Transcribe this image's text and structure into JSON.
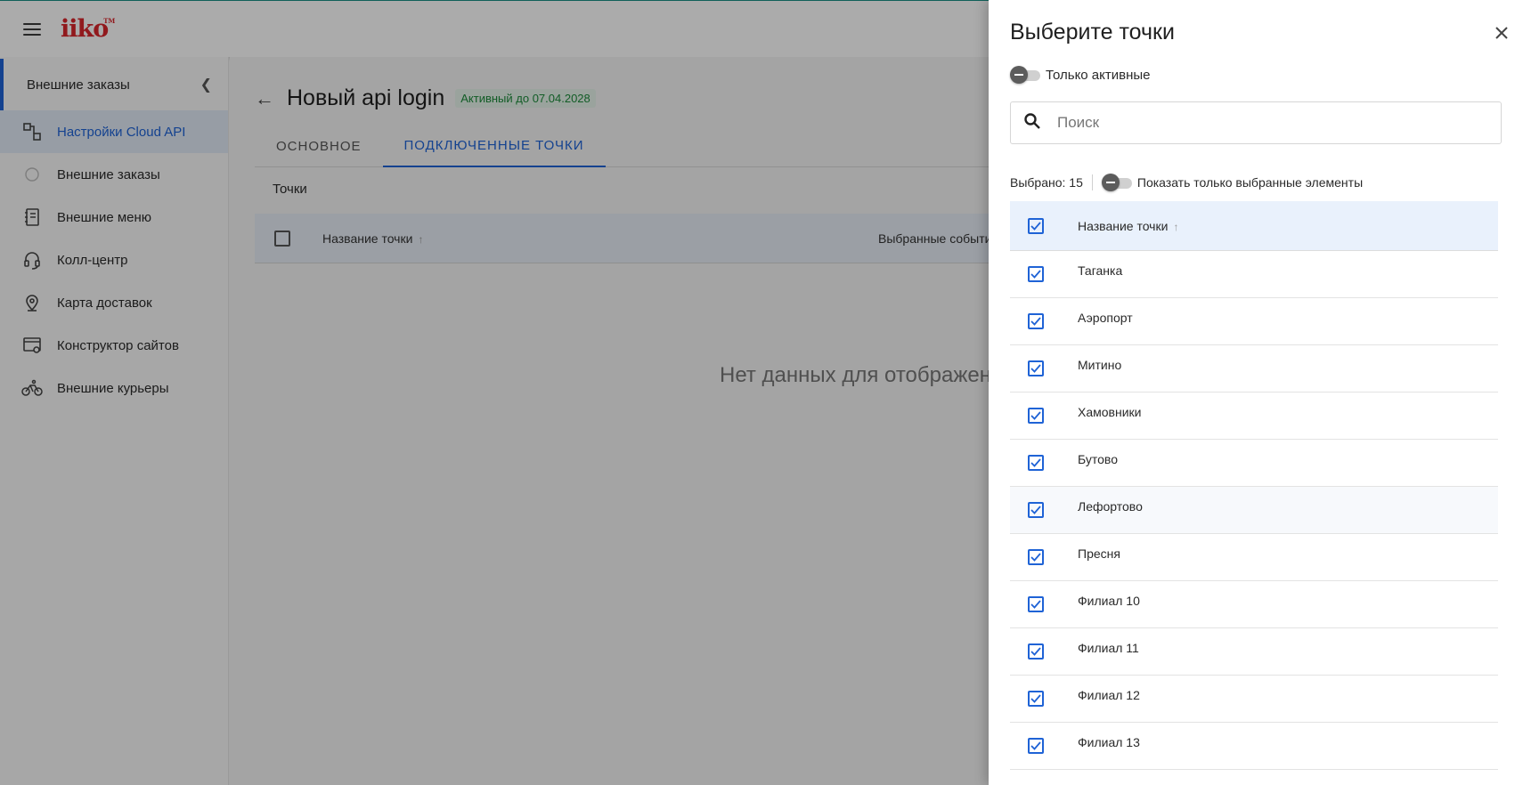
{
  "app": {
    "logo": "iiko",
    "logo_tm": "TM"
  },
  "sidebar": {
    "section_title": "Внешние заказы",
    "items": [
      {
        "label": "Настройки Cloud API",
        "icon": "cloud-api-settings-icon",
        "active": true
      },
      {
        "label": "Внешние заказы",
        "icon": "external-orders-icon",
        "active": false
      },
      {
        "label": "Внешние меню",
        "icon": "external-menu-icon",
        "active": false
      },
      {
        "label": "Колл-центр",
        "icon": "headset-icon",
        "active": false
      },
      {
        "label": "Карта доставок",
        "icon": "map-pin-icon",
        "active": false
      },
      {
        "label": "Конструктор сайтов",
        "icon": "site-builder-icon",
        "active": false
      },
      {
        "label": "Внешние курьеры",
        "icon": "bicycle-icon",
        "active": false
      }
    ]
  },
  "page": {
    "title": "Новый api login",
    "status": "Активный до 07.04.2028",
    "tabs": [
      {
        "label": "ОСНОВНОЕ",
        "active": false
      },
      {
        "label": "ПОДКЛЮЧЕННЫЕ ТОЧКИ",
        "active": true
      }
    ],
    "section_label": "Точки",
    "table": {
      "col_name": "Название точки",
      "col_events": "Выбранные события"
    },
    "empty_text": "Нет данных для отображения"
  },
  "drawer": {
    "title": "Выберите точки",
    "only_active_label": "Только активные",
    "search_placeholder": "Поиск",
    "selected_text": "Выбрано: 15",
    "show_selected_label": "Показать только выбранные элементы",
    "column_header": "Название точки",
    "rows": [
      "Таганка",
      "Аэропорт",
      "Митино",
      "Хамовники",
      "Бутово",
      "Лефортово",
      "Пресня",
      "Филиал 10",
      "Филиал 11",
      "Филиал 12",
      "Филиал 13"
    ]
  },
  "colors": {
    "accent": "#1f63d6",
    "brand": "#d8262c",
    "status_green": "#1b8a3a"
  }
}
